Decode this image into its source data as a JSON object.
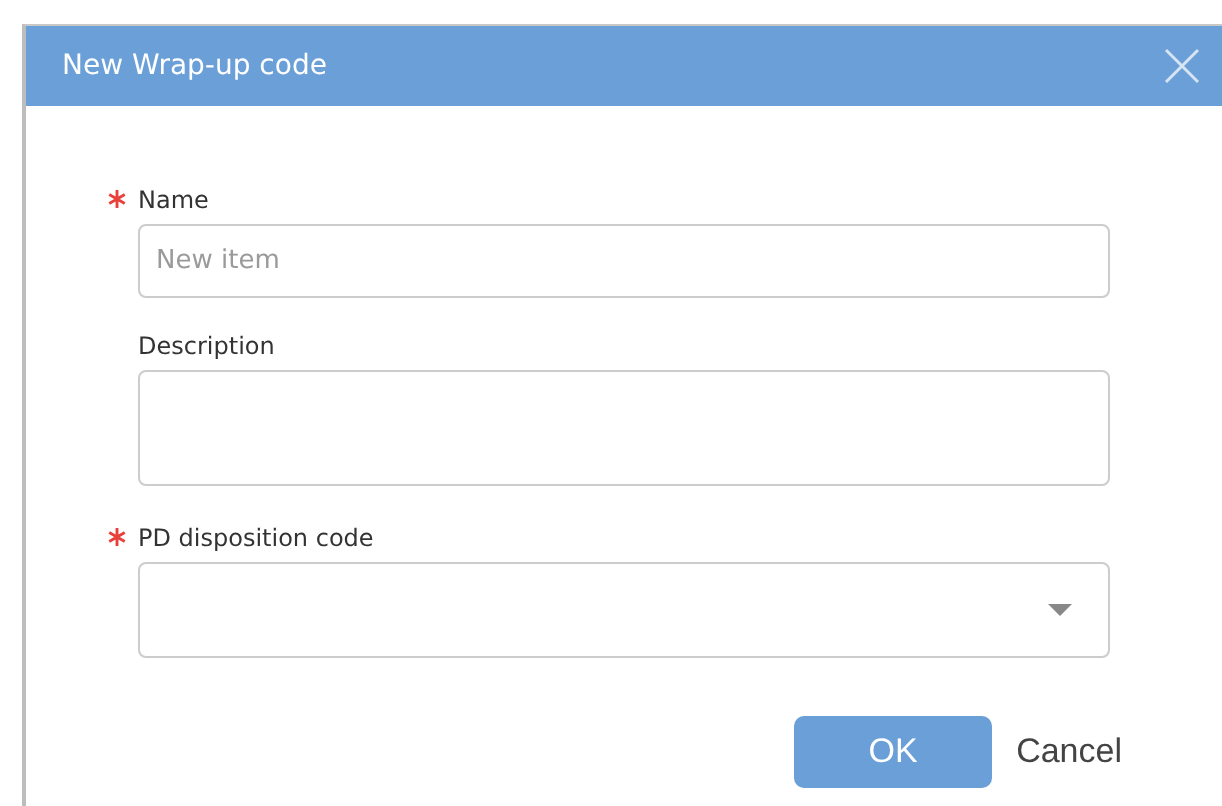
{
  "dialog": {
    "title": "New Wrap-up code"
  },
  "fields": [
    {
      "kind": "text",
      "label": "Name",
      "required": true,
      "placeholder": "New item"
    },
    {
      "kind": "textarea",
      "label": "Description",
      "required": false
    },
    {
      "kind": "select",
      "label": "PD disposition code",
      "required": true
    }
  ],
  "buttons": [
    {
      "kind": "primary",
      "label": "OK"
    },
    {
      "kind": "link",
      "label": "Cancel"
    }
  ]
}
